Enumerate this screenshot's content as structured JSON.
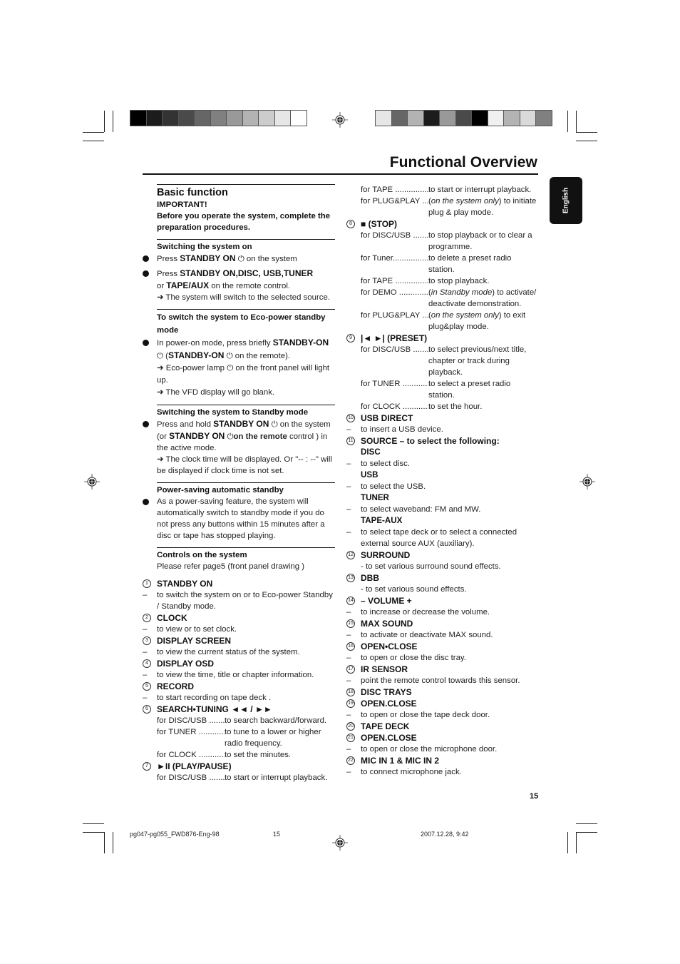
{
  "header": {
    "title": "Functional Overview",
    "language_tab": "English",
    "color_bar_left": [
      "#000000",
      "#1c1c1c",
      "#333333",
      "#4a4a4a",
      "#666666",
      "#808080",
      "#999999",
      "#b3b3b3",
      "#cccccc",
      "#e6e6e6",
      "#ffffff"
    ],
    "color_bar_right": [
      "#e6e6e6",
      "#666666",
      "#b3b3b3",
      "#1c1c1c",
      "#999999",
      "#4a4a4a",
      "#000000",
      "#f0f0f0",
      "#b3b3b3",
      "#d9d9d9",
      "#808080"
    ]
  },
  "left": {
    "basic_function": {
      "heading": "Basic function",
      "important": "IMPORTANT!",
      "important_text": "Before you operate the system, complete the preparation procedures."
    },
    "switch_on": {
      "heading": "Switching the system on",
      "b1_pre": "Press ",
      "b1_bold": "STANDBY ON",
      "b1_post": " on the system",
      "b2_pre": "Press ",
      "b2_bold": "STANDBY ON,DISC, USB,TUNER",
      "b2_mid": "or ",
      "b2_bold2": "TAPE/AUX",
      "b2_post": " on the remote control.",
      "b2_result": "The system will switch to the selected source."
    },
    "eco_power": {
      "heading": "To switch the system to Eco-power standby mode",
      "b1_pre": "In power-on mode, press briefly ",
      "b1_bold": "STANDBY-ON",
      "b1_paren_bold": "STANDBY-ON",
      "b1_post": " on the remote).",
      "r1": "Eco-power lamp",
      "r1_post": " on the front panel will light up.",
      "r2": "The VFD display will go blank."
    },
    "standby_mode": {
      "heading": "Switching the system to Standby mode",
      "b1_pre": "Press and hold ",
      "b1_bold": "STANDBY ON",
      "b1_mid": " on the system (or ",
      "b1_bold2": "STANDBY ON",
      "b1_mid2": "on the remote",
      "b1_post": " control ) in the active mode.",
      "result": "The clock time will be displayed. Or \"-- : --\" will be displayed if clock time is not set."
    },
    "power_saving": {
      "heading": "Power-saving automatic standby",
      "text": "As a power-saving feature, the system will automatically switch to standby mode if you do not press any buttons within 15 minutes after a disc or tape has stopped playing."
    },
    "controls": {
      "heading": "Controls on the system",
      "text": "Please refer page5 (front panel drawing )"
    },
    "items": [
      {
        "num": "1",
        "label": "STANDBY ON",
        "desc": "to switch the system on or to Eco-power Standby / Standby mode."
      },
      {
        "num": "2",
        "label": "CLOCK",
        "desc": "to view or to set clock."
      },
      {
        "num": "3",
        "label": "DISPLAY SCREEN",
        "desc": "to view the current status of the system."
      },
      {
        "num": "4",
        "label": "DISPLAY OSD",
        "desc": "to view the time, title or chapter information."
      },
      {
        "num": "5",
        "label": "RECORD",
        "desc": "to start recording on tape deck ."
      },
      {
        "num": "6",
        "label": "SEARCH•TUNING ◄◄ / ►►",
        "rows": [
          {
            "k": "for DISC/USB .........",
            "v": "to search backward/forward."
          },
          {
            "k": "for TUNER ..............",
            "v": "to tune to a lower or higher radio frequency."
          },
          {
            "k": "for CLOCK ..............",
            "v": "to set the minutes."
          }
        ]
      },
      {
        "num": "7",
        "label": "►II (PLAY/PAUSE)",
        "rows": [
          {
            "k": "for DISC/USB .........",
            "v": "to start or interrupt playback."
          }
        ]
      }
    ]
  },
  "right": {
    "continued_rows": [
      {
        "k": "for TAPE ....................",
        "v": "to start or interrupt playback."
      },
      {
        "k": "for PLUG&PLAY ...",
        "v_italic": "on the system only",
        "v": ") to initiate plug & play mode."
      }
    ],
    "items": [
      {
        "num": "8",
        "label": "■ (STOP)",
        "rows": [
          {
            "k": "for DISC/USB .........",
            "v": "to stop playback or to clear a programme."
          },
          {
            "k": "for  Tuner.................",
            "v": "to delete a preset radio station."
          },
          {
            "k": "for TAPE ....................",
            "v": "to stop playback."
          },
          {
            "k": "for DEMO ...............",
            "v_italic": "in Standby mode",
            "v": ") to activate/ deactivate demonstration."
          },
          {
            "k": "for PLUG&PLAY ...",
            "v_italic": "on the system only",
            "v": ") to exit plug&play mode."
          }
        ]
      },
      {
        "num": "9",
        "label": "|◄ ►| (PRESET)",
        "rows": [
          {
            "k": "for DISC/USB .........",
            "v": "to select previous/next title, chapter or track during playback."
          },
          {
            "k": "for TUNER ..............",
            "v": "to select a preset radio station."
          },
          {
            "k": "for CLOCK .............",
            "v": "to set the hour."
          }
        ]
      },
      {
        "num": "10",
        "label": "USB DIRECT",
        "desc": "to insert a USB device."
      },
      {
        "num": "11",
        "label": "SOURCE  – to select the following:"
      }
    ],
    "sources": [
      {
        "label": "DISC",
        "desc": "to select disc."
      },
      {
        "label": "USB",
        "desc": "to select the USB."
      },
      {
        "label": "TUNER",
        "desc": "to select waveband: FM and MW."
      },
      {
        "label": "TAPE-AUX",
        "desc": "to select tape deck  or to select a connected external source AUX (auxiliary)."
      }
    ],
    "items2": [
      {
        "num": "12",
        "label": "SURROUND",
        "note": "- to set various surround sound effects."
      },
      {
        "num": "13",
        "label": "DBB",
        "note": "- to set various sound effects."
      },
      {
        "num": "14",
        "label": "– VOLUME +",
        "desc": "to increase or decrease the volume."
      },
      {
        "num": "15",
        "label": "MAX SOUND",
        "desc": "to activate or deactivate MAX sound."
      },
      {
        "num": "16",
        "label": "OPEN•CLOSE",
        "desc": "to open or close the disc tray."
      },
      {
        "num": "17",
        "label": "IR SENSOR",
        "desc": "point the remote control towards this sensor."
      },
      {
        "num": "18",
        "label": "DISC TRAYS"
      },
      {
        "num": "19",
        "label": "OPEN.CLOSE",
        "desc": "to open or close the tape deck door."
      },
      {
        "num": "20",
        "label": "TAPE DECK"
      },
      {
        "num": "21",
        "label": "OPEN.CLOSE",
        "desc": "to open or close the microphone door."
      },
      {
        "num": "22",
        "label": "MIC IN 1 & MIC IN 2",
        "desc": "to connect microphone jack."
      }
    ]
  },
  "footer": {
    "page_number": "15",
    "file_name": "pg047-pg055_FWD876-Eng-98",
    "sheet_number": "15",
    "datetime": "2007.12.28, 9:42"
  },
  "icons": {
    "arrow": "➜",
    "power": "⏻"
  }
}
